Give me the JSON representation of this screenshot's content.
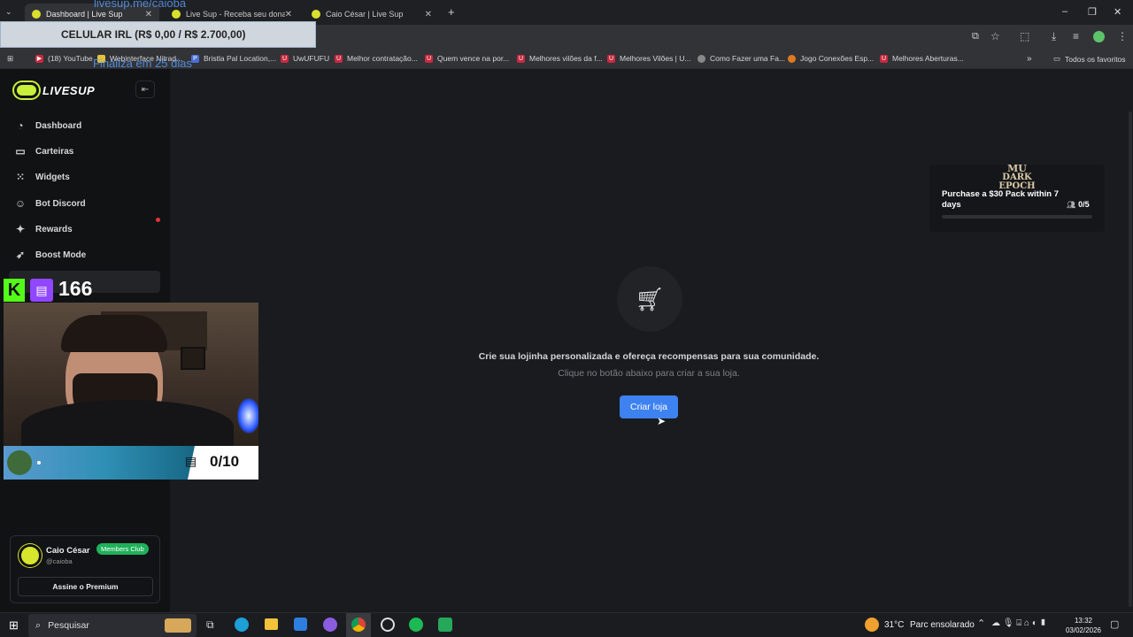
{
  "browser": {
    "tabs": [
      {
        "title": "Dashboard | Live Sup",
        "active": true
      },
      {
        "title": "Live Sup - Receba seu donate d",
        "active": false
      },
      {
        "title": "Caio César | Live Sup",
        "active": false
      }
    ],
    "bookmarks": [
      "(18) YouTube",
      "Webinterface Nitrad...",
      "Bristla Pal Location,...",
      "UwUFUFU",
      "Melhor contratação...",
      "Quem vence na por...",
      "Melhores vilões da f...",
      "Melhores Vilões | U...",
      "Como Fazer uma Fa...",
      "Jogo Conexões Esp...",
      "Melhores Aberturas..."
    ],
    "all_bookmarks": "Todos os favoritos"
  },
  "overlay": {
    "url_text": "livesup.me/caioba",
    "goal_text": "CELULAR IRL (R$ 0,00 / R$ 2.700,00)",
    "goal_sub": "Finaliza em 25 dias",
    "viewer_count": "166",
    "sub_goal": "0/10"
  },
  "sidebar": {
    "logo": "LIVESUP",
    "items": [
      {
        "label": "Dashboard",
        "icon": "gauge-icon"
      },
      {
        "label": "Carteiras",
        "icon": "wallet-icon"
      },
      {
        "label": "Widgets",
        "icon": "widgets-icon"
      },
      {
        "label": "Bot Discord",
        "icon": "discord-icon"
      },
      {
        "label": "Rewards",
        "icon": "sparkle-icon"
      },
      {
        "label": "Boost Mode",
        "icon": "rocket-icon"
      }
    ],
    "user": {
      "name": "Caio César",
      "handle": "@caioba",
      "badge": "Members Club",
      "premium_label": "Assine o Premium"
    }
  },
  "main": {
    "empty_title": "Crie sua lojinha personalizada e ofereça recompensas para sua comunidade.",
    "empty_sub": "Clique no botão abaixo para criar a sua loja.",
    "create_button": "Criar loja"
  },
  "promo": {
    "logo_top": "MU",
    "logo_bottom": "DARK EPOCH",
    "text": "Purchase a $30 Pack within 7 days",
    "progress": "0/5"
  },
  "taskbar": {
    "search_placeholder": "Pesquisar",
    "weather_temp": "31°C",
    "weather_desc": "Parc ensolarado",
    "time": "13:32",
    "date": "03/02/2026"
  }
}
